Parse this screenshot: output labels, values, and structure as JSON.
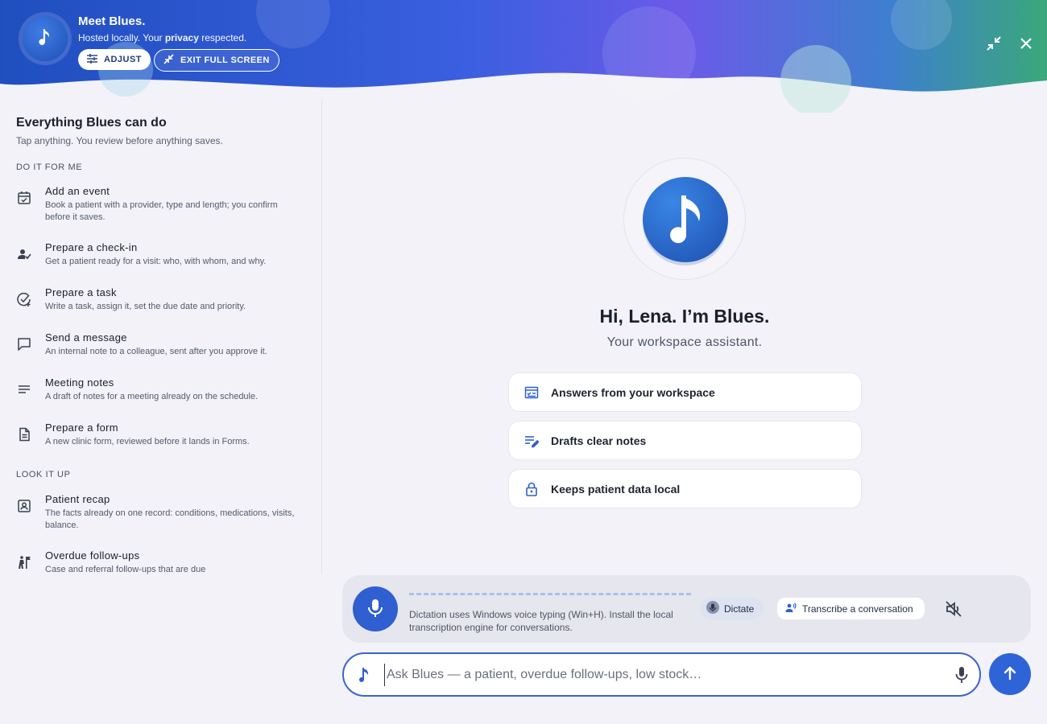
{
  "header": {
    "title": "Meet Blues.",
    "subtitle_pre": "Hosted locally. Your ",
    "subtitle_bold": "privacy",
    "subtitle_post": " respected.",
    "adjust_label": "ADJUST",
    "exit_label": "EXIT FULL SCREEN",
    "icons": [
      "music-note-icon",
      "sliders-icon",
      "exit-fullscreen-icon",
      "collapse-icon",
      "close-icon"
    ]
  },
  "sidebar": {
    "title": "Everything Blues can do",
    "subtitle": "Tap anything. You review before anything saves.",
    "sections": [
      {
        "label": "DO IT FOR ME",
        "items": [
          {
            "icon": "calendar-check-icon",
            "title": "Add an event",
            "desc": "Book a patient with a provider, type and length; you confirm before it saves."
          },
          {
            "icon": "person-check-icon",
            "title": "Prepare a check-in",
            "desc": "Get a patient ready for a visit: who, with whom, and why."
          },
          {
            "icon": "task-add-icon",
            "title": "Prepare a task",
            "desc": "Write a task, assign it, set the due date and priority."
          },
          {
            "icon": "message-icon",
            "title": "Send a message",
            "desc": "An internal note to a colleague, sent after you approve it."
          },
          {
            "icon": "notes-icon",
            "title": "Meeting notes",
            "desc": "A draft of notes for a meeting already on the schedule."
          },
          {
            "icon": "document-icon",
            "title": "Prepare a form",
            "desc": "A new clinic form, reviewed before it lands in Forms."
          }
        ]
      },
      {
        "label": "LOOK IT UP",
        "items": [
          {
            "icon": "patient-card-icon",
            "title": "Patient recap",
            "desc": "The facts already on one record: conditions, medications, visits, balance."
          },
          {
            "icon": "follow-up-icon",
            "title": "Overdue follow-ups",
            "desc": "Case and referral follow-ups that are due"
          }
        ]
      }
    ]
  },
  "main": {
    "greeting": "Hi, Lena. I’m Blues.",
    "tagline": "Your workspace assistant.",
    "features": [
      {
        "icon": "workspace-check-icon",
        "label": "Answers from your workspace"
      },
      {
        "icon": "edit-notes-icon",
        "label": "Drafts clear notes"
      },
      {
        "icon": "lock-icon",
        "label": "Keeps patient data local"
      }
    ]
  },
  "dictation": {
    "note": "Dictation uses Windows voice typing (Win+H). Install the local transcription engine for conversations.",
    "dictate_label": "Dictate",
    "transcribe_label": "Transcribe a conversation",
    "icons": [
      "microphone-icon",
      "record-voice-icon",
      "volume-off-icon"
    ]
  },
  "input": {
    "placeholder": "Ask Blues — a patient, overdue follow-ups, low stock…",
    "value": ""
  },
  "colors": {
    "accent": "#2f63d8",
    "header_gradient": [
      "#1f4fc2",
      "#6a5fe6",
      "#3aa57a"
    ]
  }
}
